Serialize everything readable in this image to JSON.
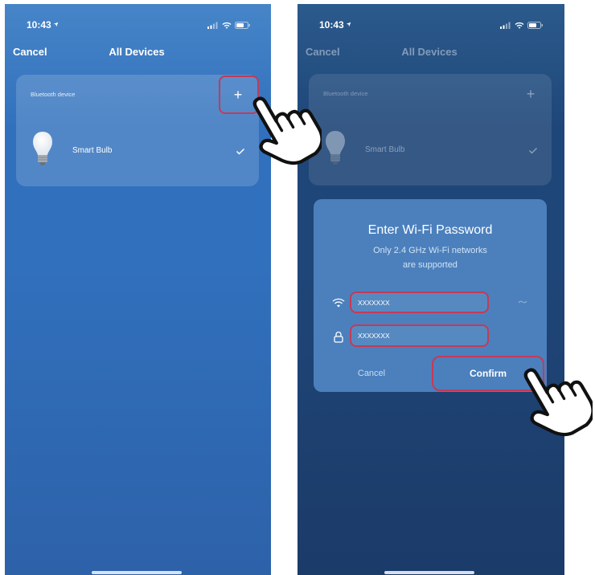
{
  "left_screen": {
    "status": {
      "time": "10:43"
    },
    "nav": {
      "cancel": "Cancel",
      "title": "All Devices"
    },
    "card": {
      "section_label": "Bluetooth device",
      "add_button": "+",
      "device_name": "Smart Bulb"
    }
  },
  "right_screen": {
    "status": {
      "time": "10:43"
    },
    "nav": {
      "cancel": "Cancel",
      "title": "All Devices"
    },
    "card": {
      "section_label": "Bluetooth device",
      "add_button": "+",
      "device_name": "Smart Bulb"
    },
    "dialog": {
      "title": "Enter Wi-Fi Password",
      "subtitle_line1": "Only 2.4 GHz Wi-Fi networks",
      "subtitle_line2": "are supported",
      "ssid_value": "XXXXXXX",
      "password_value": "XXXXXXX",
      "cancel": "Cancel",
      "confirm": "Confirm"
    }
  },
  "icons": {
    "location": "location-arrow-icon",
    "signal": "signal-icon",
    "wifi_status": "wifi-status-icon",
    "battery": "battery-icon",
    "bulb": "bulb-icon",
    "check": "check-icon",
    "wifi": "wifi-icon",
    "lock": "lock-icon",
    "network_menu": "network-menu-icon",
    "pointer": "pointer-hand-icon"
  },
  "colors": {
    "highlight": "#c43a57",
    "left_bg_top": "#4785c8",
    "left_bg_mid": "#3170bd",
    "left_bg_bottom": "#2d62a9",
    "right_bg_top": "#2b5a8c",
    "right_bg_mid": "#1f4678",
    "right_bg_bottom": "#1b3b69",
    "dialog_bg": "#4b80bd",
    "text": "#ffffff"
  }
}
